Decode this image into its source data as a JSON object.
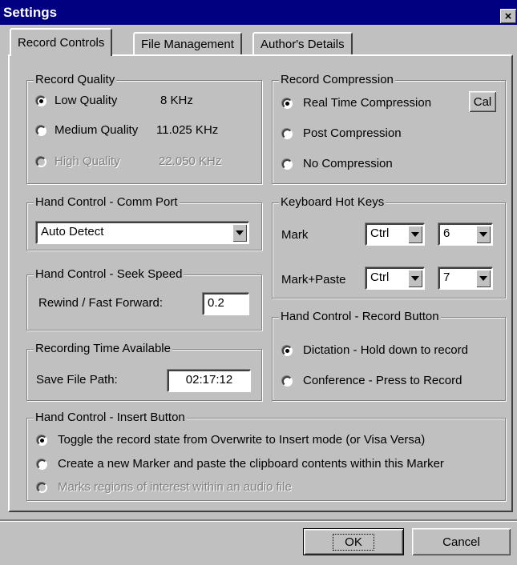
{
  "window": {
    "title": "Settings",
    "close_label": "×"
  },
  "tabs": [
    {
      "label": "Record Controls"
    },
    {
      "label": "File Management"
    },
    {
      "label": "Author's Details"
    }
  ],
  "record_quality": {
    "legend": "Record Quality",
    "options": [
      {
        "label": "Low Quality",
        "rate": "8 KHz"
      },
      {
        "label": "Medium Quality",
        "rate": "11.025 KHz"
      },
      {
        "label": "High Quality",
        "rate": "22.050 KHz"
      }
    ]
  },
  "record_compression": {
    "legend": "Record Compression",
    "options": [
      {
        "label": "Real Time Compression"
      },
      {
        "label": "Post Compression"
      },
      {
        "label": "No Compression"
      }
    ],
    "cal_label": "Cal"
  },
  "comm_port": {
    "legend": "Hand Control - Comm Port",
    "selected": "Auto Detect"
  },
  "hot_keys": {
    "legend": "Keyboard Hot Keys",
    "mark_label": "Mark",
    "mark_mod": "Ctrl",
    "mark_key": "6",
    "markpaste_label": "Mark+Paste",
    "markpaste_mod": "Ctrl",
    "markpaste_key": "7"
  },
  "seek_speed": {
    "legend": "Hand Control - Seek Speed",
    "label": "Rewind / Fast Forward:",
    "value": "0.2"
  },
  "record_button": {
    "legend": "Hand Control - Record Button",
    "options": [
      {
        "label": "Dictation - Hold down to record"
      },
      {
        "label": "Conference - Press to Record"
      }
    ]
  },
  "recording_time": {
    "legend": "Recording Time Available",
    "label": "Save File Path:",
    "value": "02:17:12"
  },
  "insert_button": {
    "legend": "Hand Control - Insert Button",
    "options": [
      {
        "label": "Toggle the record state from Overwrite to Insert mode (or Visa Versa)"
      },
      {
        "label": "Create a new Marker and paste the clipboard contents within this Marker"
      },
      {
        "label": "Marks regions of interest within an audio file"
      }
    ]
  },
  "footer": {
    "ok_label": "OK",
    "cancel_label": "Cancel"
  }
}
